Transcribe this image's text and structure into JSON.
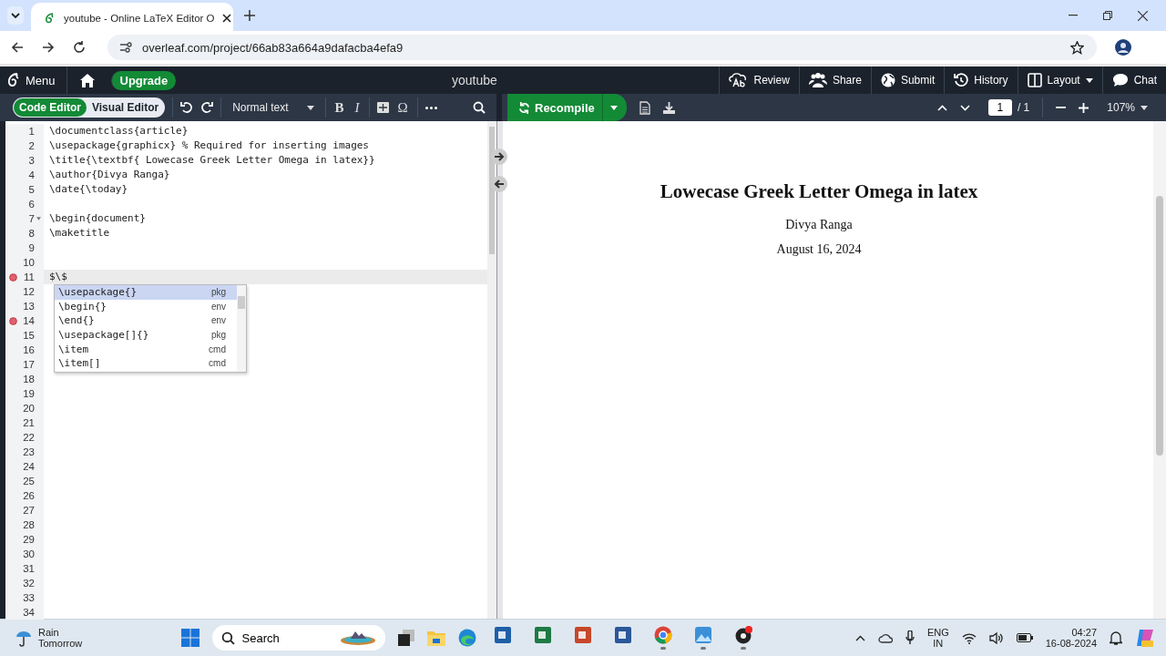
{
  "browser": {
    "tab_title": "youtube - Online LaTeX Editor O",
    "url": "overleaf.com/project/66ab83a664a9dafacba4efa9"
  },
  "header": {
    "menu": "Menu",
    "upgrade": "Upgrade",
    "project": "youtube",
    "actions": [
      {
        "label": "Review",
        "kind": "review",
        "dropdown": false
      },
      {
        "label": "Share",
        "kind": "share",
        "dropdown": false
      },
      {
        "label": "Submit",
        "kind": "globe",
        "dropdown": false
      },
      {
        "label": "History",
        "kind": "history",
        "dropdown": false
      },
      {
        "label": "Layout",
        "kind": "layout",
        "dropdown": true
      },
      {
        "label": "Chat",
        "kind": "chat",
        "dropdown": false
      }
    ]
  },
  "toolbar": {
    "modes": [
      {
        "label": "Code Editor",
        "selected": true
      },
      {
        "label": "Visual Editor",
        "selected": false
      }
    ],
    "style": "Normal text",
    "bold": "B",
    "italic": "I",
    "omega": "Ω",
    "recompile": "Recompile",
    "page": "1",
    "page_total": "/ 1",
    "zoom": "107%"
  },
  "editor": {
    "lines": [
      {
        "number": "1",
        "text": "\\documentclass{article}",
        "error": false,
        "fold": false,
        "active": false
      },
      {
        "number": "2",
        "text": "\\usepackage{graphicx} % Required for inserting images",
        "error": false,
        "fold": false,
        "active": false
      },
      {
        "number": "3",
        "text": "\\title{\\textbf{ Lowecase Greek Letter Omega in latex}}",
        "error": false,
        "fold": false,
        "active": false
      },
      {
        "number": "4",
        "text": "\\author{Divya Ranga}",
        "error": false,
        "fold": false,
        "active": false
      },
      {
        "number": "5",
        "text": "\\date{\\today}",
        "error": false,
        "fold": false,
        "active": false
      },
      {
        "number": "6",
        "error": false,
        "fold": false,
        "active": false
      },
      {
        "number": "7",
        "text": "\\begin{document}",
        "error": false,
        "fold": true,
        "active": false
      },
      {
        "number": "8",
        "text": "\\maketitle",
        "error": false,
        "fold": false,
        "active": false
      },
      {
        "number": "9",
        "error": false,
        "fold": false,
        "active": false
      },
      {
        "number": "10",
        "error": false,
        "fold": false,
        "active": false
      },
      {
        "number": "11",
        "text": "$\\$",
        "error": true,
        "fold": false,
        "active": true
      },
      {
        "number": "12",
        "error": false,
        "fold": false,
        "active": false
      },
      {
        "number": "13",
        "error": false,
        "fold": false,
        "active": false
      },
      {
        "number": "14",
        "error": true,
        "fold": false,
        "active": false
      },
      {
        "number": "15",
        "error": false,
        "fold": false,
        "active": false
      },
      {
        "number": "16",
        "error": false,
        "fold": false,
        "active": false
      },
      {
        "number": "17",
        "error": false,
        "fold": false,
        "active": false
      },
      {
        "number": "18",
        "error": false,
        "fold": false,
        "active": false
      },
      {
        "number": "19",
        "error": false,
        "fold": false,
        "active": false
      },
      {
        "number": "20",
        "error": false,
        "fold": false,
        "active": false
      },
      {
        "number": "21",
        "error": false,
        "fold": false,
        "active": false
      },
      {
        "number": "22",
        "error": false,
        "fold": false,
        "active": false
      },
      {
        "number": "23",
        "error": false,
        "fold": false,
        "active": false
      },
      {
        "number": "24",
        "error": false,
        "fold": false,
        "active": false
      },
      {
        "number": "25",
        "error": false,
        "fold": false,
        "active": false
      },
      {
        "number": "26",
        "error": false,
        "fold": false,
        "active": false
      },
      {
        "number": "27",
        "error": false,
        "fold": false,
        "active": false
      },
      {
        "number": "28",
        "error": false,
        "fold": false,
        "active": false
      },
      {
        "number": "29",
        "error": false,
        "fold": false,
        "active": false
      },
      {
        "number": "30",
        "error": false,
        "fold": false,
        "active": false
      },
      {
        "number": "31",
        "error": false,
        "fold": false,
        "active": false
      },
      {
        "number": "32",
        "error": false,
        "fold": false,
        "active": false
      },
      {
        "number": "33",
        "error": false,
        "fold": false,
        "active": false
      },
      {
        "number": "34",
        "error": false,
        "fold": false,
        "active": false
      }
    ],
    "autocomplete": [
      {
        "label": "\\usepackage{}",
        "type": "pkg",
        "selected": true
      },
      {
        "label": "\\begin{}",
        "type": "env",
        "selected": false
      },
      {
        "label": "\\end{}",
        "type": "env",
        "selected": false
      },
      {
        "label": "\\usepackage[]{}",
        "type": "pkg",
        "selected": false
      },
      {
        "label": "\\item",
        "type": "cmd",
        "selected": false
      },
      {
        "label": "\\item[]",
        "type": "cmd",
        "selected": false
      }
    ]
  },
  "pdf": {
    "title": "Lowecase Greek Letter Omega in latex",
    "author": "Divya Ranga",
    "date": "August 16, 2024"
  },
  "taskbar": {
    "weather": [
      "Rain",
      "Tomorrow"
    ],
    "search": "Search",
    "apps": [
      {
        "kind": "store",
        "running": false
      },
      {
        "kind": "excel",
        "running": false
      },
      {
        "kind": "powerpoint",
        "running": false
      },
      {
        "kind": "word",
        "running": false
      },
      {
        "kind": "chrome",
        "running": true
      },
      {
        "kind": "photos",
        "running": true
      },
      {
        "kind": "obs",
        "running": true
      }
    ],
    "language": [
      "ENG",
      "IN"
    ],
    "time": "04:27",
    "date": "16-08-2024"
  }
}
